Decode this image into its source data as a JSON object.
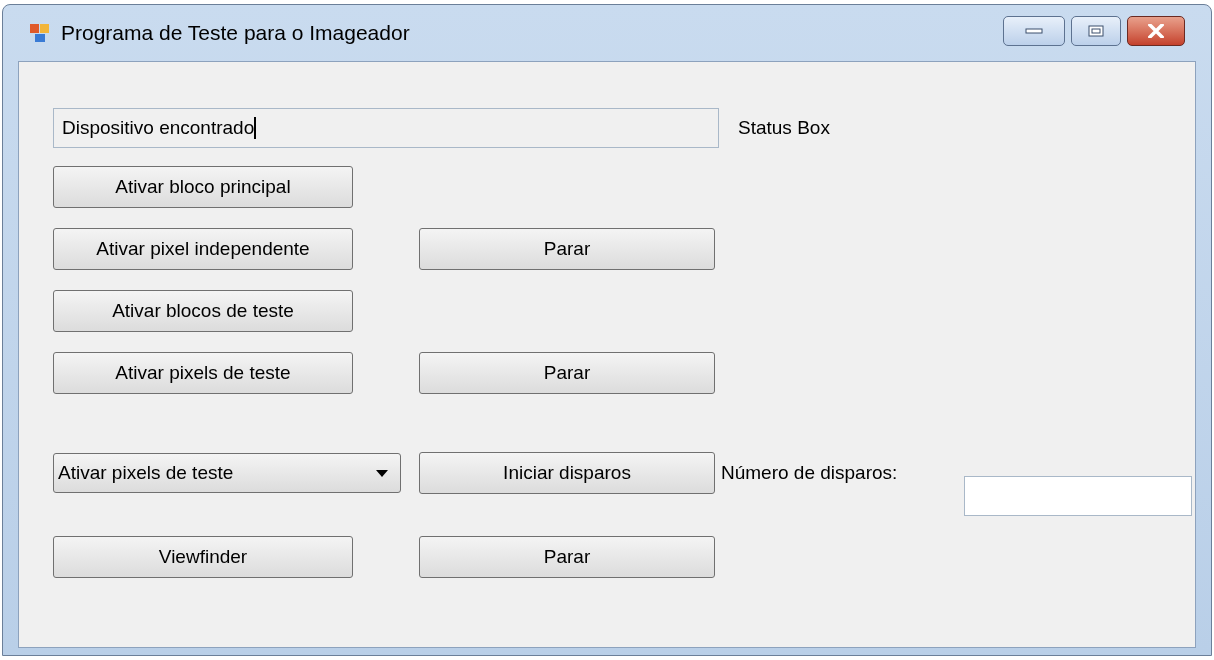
{
  "window": {
    "title": "Programa de Teste para o Imageador"
  },
  "status": {
    "value": "Dispositivo encontrado",
    "label": "Status Box"
  },
  "rows": [
    {
      "left": {
        "kind": "button",
        "text": "Ativar bloco principal"
      }
    },
    {
      "left": {
        "kind": "button",
        "text": "Ativar pixel independente"
      },
      "middle": {
        "kind": "button",
        "text": "Parar"
      }
    },
    {
      "left": {
        "kind": "button",
        "text": "Ativar blocos de teste"
      }
    },
    {
      "left": {
        "kind": "button",
        "text": "Ativar pixels de teste"
      },
      "middle": {
        "kind": "button",
        "text": "Parar"
      }
    },
    {
      "left": {
        "kind": "combobox",
        "text": "Ativar pixels de teste"
      },
      "middle": {
        "kind": "button",
        "text": "Iniciar disparos"
      },
      "label": "Número de disparos:"
    },
    {
      "left": {
        "kind": "button",
        "text": "Viewfinder"
      },
      "middle": {
        "kind": "button",
        "text": "Parar"
      }
    }
  ]
}
